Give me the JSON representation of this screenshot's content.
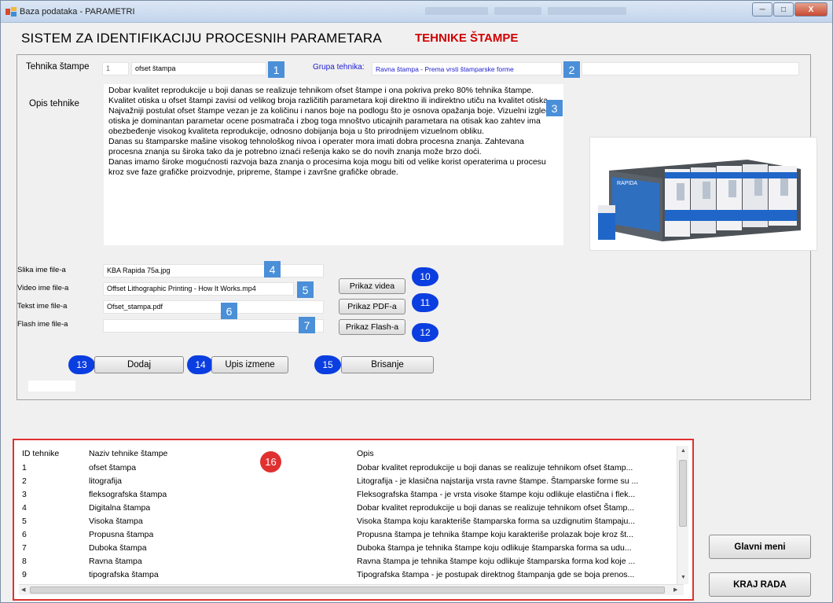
{
  "window": {
    "title": "Baza podataka - PARAMETRI",
    "minimize": "─",
    "maximize": "□",
    "close": "X"
  },
  "header": {
    "title": "SISTEM ZA IDENTIFIKACIJU PROCESNIH PARAMETARA",
    "subtitle": "TEHNIKE ŠTAMPE"
  },
  "form": {
    "tehnika_label": "Tehnika štampe",
    "tehnika_id": "1",
    "tehnika_name": "ofset štampa",
    "grupa_label": "Grupa tehnika:",
    "grupa_value": "Ravna štampa - Prema vrsti štamparske forme",
    "opis_label": "Opis tehnike",
    "opis_paragraphs": [
      "Dobar kvalitet reprodukcije u boji danas se realizuje tehnikom ofset štampe i ona pokriva preko 80% tehnika štampe. Kvalitet otiska u ofset štampi zavisi od velikog broja različitih parametara koji direktno ili indirektno utiču na kvalitet otiska.",
      "Najvažniji postulat ofset štampe vezan je za količinu i nanos boje na podlogu što je osnova opažanja boje. Vizuelni izgled otiska je dominantan parametar ocene posmatrača i zbog toga mnoštvo uticajnih parametara na otisak kao zahtev ima obezbeđenje visokog kvaliteta reprodukcije, odnosno dobijanja boja u što prirodnijem vizuelnom obliku.",
      "Danas su štamparske mašine visokog tehnološkog nivoa i operater mora imati dobra procesna znanja. Zahtevana procesna znanja su široka tako da je potrebno iznaći rešenja kako se do novih znanja može brzo doći.",
      "Danas imamo široke mogućnosti razvoja baza znanja o procesima koja mogu biti od velike korist operaterima u procesu kroz sve faze grafičke proizvodnje, pripreme, štampe i završne grafičke obrade."
    ],
    "slika_label": "Slika ime file-a",
    "slika_value": "KBA Rapida 75a.jpg",
    "video_label": "Video ime file-a",
    "video_value": "Offset Lithographic Printing - How It Works.mp4",
    "tekst_label": "Tekst ime file-a",
    "tekst_value": "Ofset_stampa.pdf",
    "flash_label": "Flash ime file-a",
    "flash_value": ""
  },
  "buttons": {
    "prikaz_videa": "Prikaz videa",
    "prikaz_pdf": "Prikaz PDF-a",
    "prikaz_flash": "Prikaz Flash-a",
    "dodaj": "Dodaj",
    "upis_izmene": "Upis izmene",
    "brisanje": "Brisanje",
    "glavni_meni": "Glavni meni",
    "kraj_rada": "KRAJ RADA"
  },
  "image_label": "RAPIDA",
  "badges": [
    "1",
    "2",
    "3",
    "4",
    "5",
    "6",
    "7",
    "10",
    "11",
    "12",
    "13",
    "14",
    "15",
    "16"
  ],
  "grid": {
    "headers": [
      "ID tehnike",
      "Naziv tehnike štampe",
      "Opis"
    ],
    "rows": [
      [
        "1",
        "ofset štampa",
        "Dobar kvalitet reprodukcije u boji danas se realizuje tehnikom ofset štamp..."
      ],
      [
        "2",
        "litografija",
        "Litografija - je klasična najstarija vrsta ravne štampe. Štamparske forme su ..."
      ],
      [
        "3",
        "fleksografska štampa",
        "Fleksografska štampa - je vrsta visoke štampe koju odlikuje elastična i flek..."
      ],
      [
        "4",
        "Digitalna štampa",
        "Dobar kvalitet reprodukcije u boji danas se realizuje tehnikom ofset Štamp..."
      ],
      [
        "5",
        "Visoka štampa",
        "Visoka štampa koju karakteriše štamparska forma sa uzdignutim štampaju..."
      ],
      [
        "6",
        "Propusna štampa",
        "Propusna štampa je tehnika štampe koju karakteriše prolazak boje kroz št..."
      ],
      [
        "7",
        "Duboka štampa",
        "Duboka štampa je tehnika štampe koju odlikuje štamparska forma sa udu..."
      ],
      [
        "8",
        "Ravna štampa",
        "Ravna štampa je tehnika štampe koju odlikuje štamparska forma kod koje ..."
      ],
      [
        "9",
        "tipografska štampa",
        "Tipografska štampa - je postupak direktnog štampanja gde se boja prenos..."
      ]
    ]
  },
  "colors": {
    "badge_square": "#4a8fd8",
    "badge_pin": "#0b3ee0",
    "badge_red": "#e03030",
    "subtitle": "#d00000",
    "group_text": "#2020d0"
  }
}
